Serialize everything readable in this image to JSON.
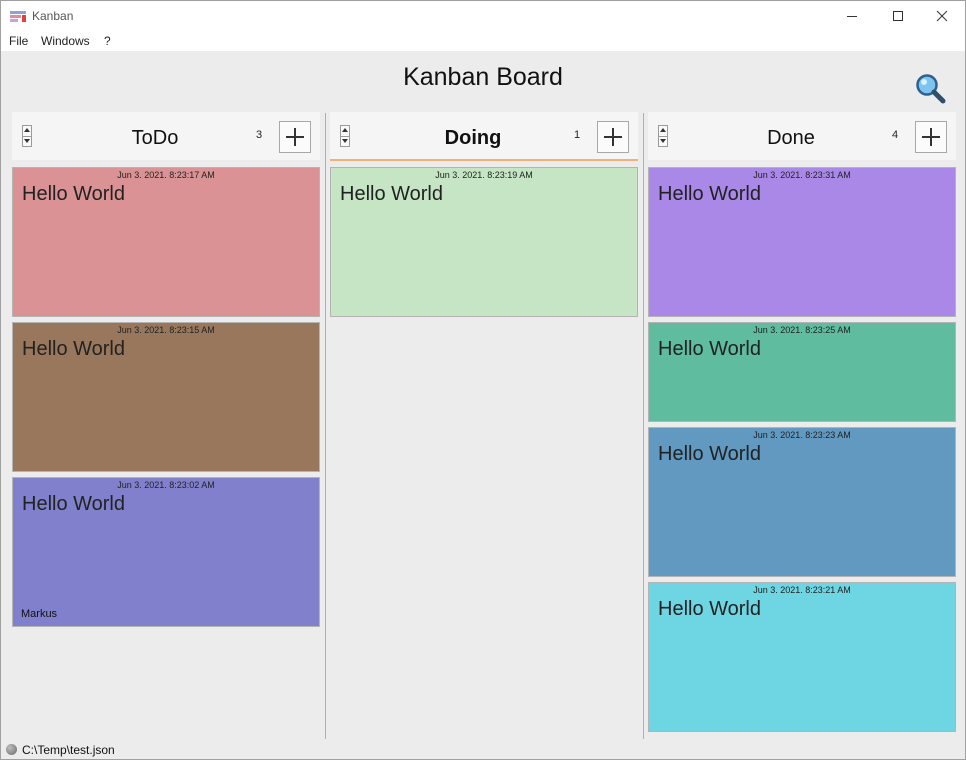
{
  "window": {
    "title": "Kanban"
  },
  "menu": {
    "file": "File",
    "windows": "Windows",
    "help": "?"
  },
  "board": {
    "title": "Kanban Board"
  },
  "columns": [
    {
      "title": "ToDo",
      "count": "3",
      "active": false,
      "cards": [
        {
          "timestamp": "Jun 3. 2021. 8:23:17 AM",
          "text": "Hello World",
          "owner": "",
          "color": "#db9294"
        },
        {
          "timestamp": "Jun 3. 2021. 8:23:15 AM",
          "text": "Hello World",
          "owner": "",
          "color": "#98775d"
        },
        {
          "timestamp": "Jun 3. 2021. 8:23:02 AM",
          "text": "Hello World",
          "owner": "Markus",
          "color": "#8080cc"
        }
      ]
    },
    {
      "title": "Doing",
      "count": "1",
      "active": true,
      "cards": [
        {
          "timestamp": "Jun 3. 2021. 8:23:19 AM",
          "text": "Hello World",
          "owner": "",
          "color": "#c5e5c5"
        }
      ]
    },
    {
      "title": "Done",
      "count": "4",
      "active": false,
      "cards": [
        {
          "timestamp": "Jun 3. 2021. 8:23:31 AM",
          "text": "Hello World",
          "owner": "",
          "color": "#aa88e8"
        },
        {
          "timestamp": "Jun 3. 2021. 8:23:25 AM",
          "text": "Hello World",
          "owner": "",
          "color": "#5fbc9f"
        },
        {
          "timestamp": "Jun 3. 2021. 8:23:23 AM",
          "text": "Hello World",
          "owner": "",
          "color": "#6199c1"
        },
        {
          "timestamp": "Jun 3. 2021. 8:23:21 AM",
          "text": "Hello World",
          "owner": "",
          "color": "#6ed5e3"
        }
      ]
    }
  ],
  "status": {
    "path": "C:\\Temp\\test.json"
  },
  "icons": {
    "app": "kanban-app-icon",
    "search": "search-icon",
    "add": "plus-icon",
    "spinner": "up-down-spinner-icon",
    "status": "status-dot-icon"
  }
}
